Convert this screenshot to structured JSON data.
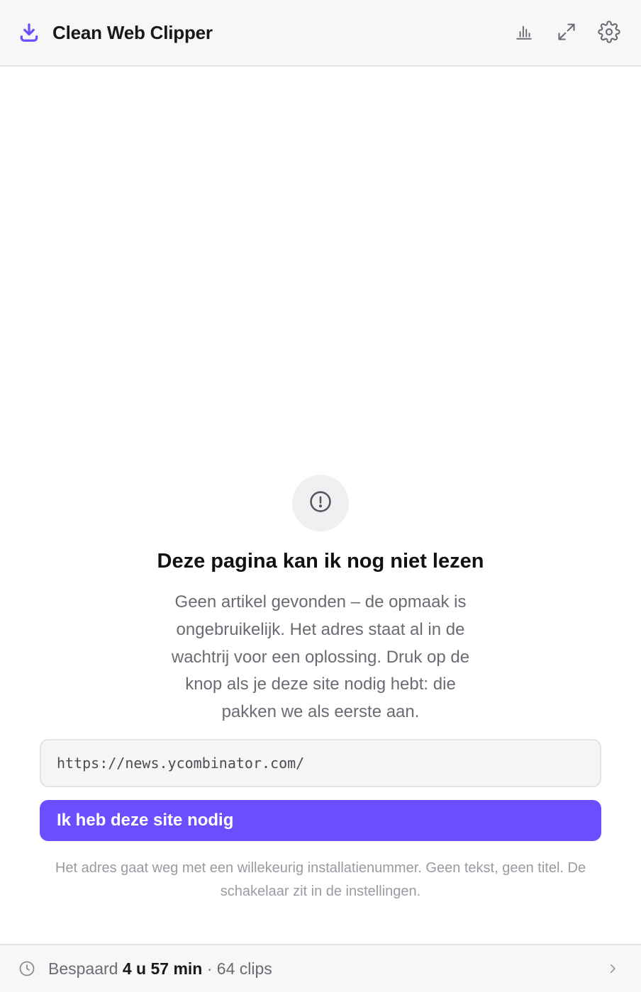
{
  "header": {
    "title": "Clean Web Clipper",
    "brand_icon": "download-icon",
    "actions": [
      {
        "name": "stats-button",
        "icon": "bar-chart-icon"
      },
      {
        "name": "expand-button",
        "icon": "expand-icon"
      },
      {
        "name": "settings-button",
        "icon": "gear-icon"
      }
    ]
  },
  "empty_state": {
    "icon": "alert-circle-icon",
    "title": "Deze pagina kan ik nog niet lezen",
    "description": "Geen artikel gevonden – de opmaak is ongebruikelijk. Het adres staat al in de wachtrij voor een oplossing. Druk op de knop als je deze site nodig hebt: die pakken we als eerste aan.",
    "url": "https://news.ycombinator.com/",
    "button_label": "Ik heb deze site nodig",
    "note": "Het adres gaat weg met een willekeurig installatienummer. Geen tekst, geen titel. De schakelaar zit in de instellingen."
  },
  "footer": {
    "saved_prefix": "Bespaard",
    "saved_time": "4 u 57 min",
    "clips": "· 64 clips"
  },
  "colors": {
    "accent": "#6b4eff",
    "header_bg": "#f7f7f8",
    "muted_text": "#6b6b73",
    "faint_text": "#9a9aa2"
  }
}
